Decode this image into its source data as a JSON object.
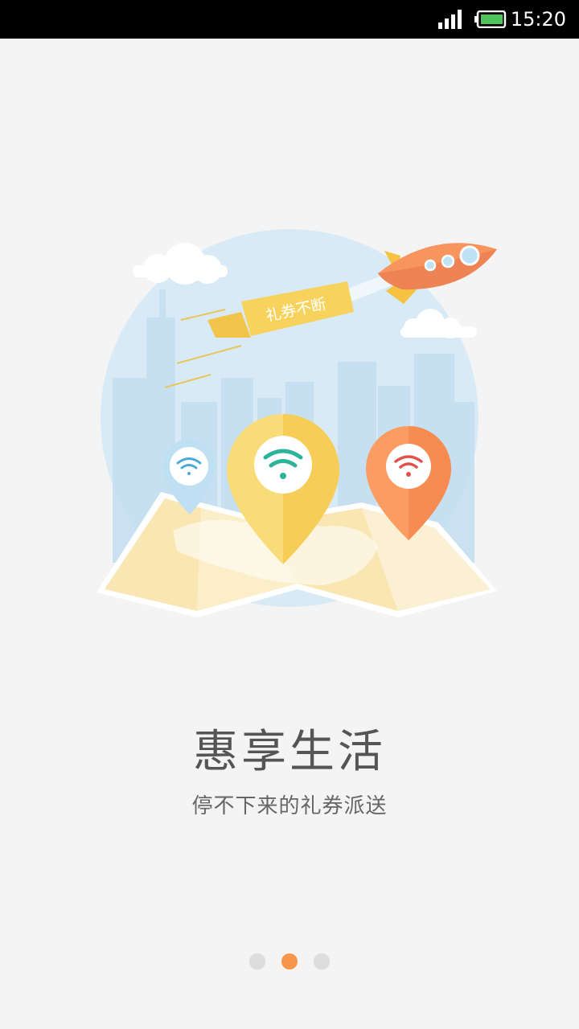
{
  "status_bar": {
    "time": "15:20",
    "signal_icon": "signal-bars-icon",
    "battery_icon": "battery-icon"
  },
  "illustration": {
    "banner_text": "礼券不断",
    "icons": [
      "cloud-icon",
      "rocket-icon",
      "map-icon",
      "location-pin-icon",
      "wifi-icon"
    ],
    "colors": {
      "circle_bg": "#d6e8f4",
      "pin_blue": "#bfe0f3",
      "pin_yellow": "#f7d36a",
      "pin_orange": "#fb9c62",
      "wifi_teal": "#2db39a",
      "wifi_red": "#e0524a",
      "map": "#fcefc8",
      "rocket": "#f7966a"
    }
  },
  "content": {
    "title": "惠享生活",
    "subtitle": "停不下来的礼券派送"
  },
  "pager": {
    "total": 3,
    "active_index": 2,
    "active_color": "#f7964a",
    "inactive_color": "#dcdcdc"
  }
}
